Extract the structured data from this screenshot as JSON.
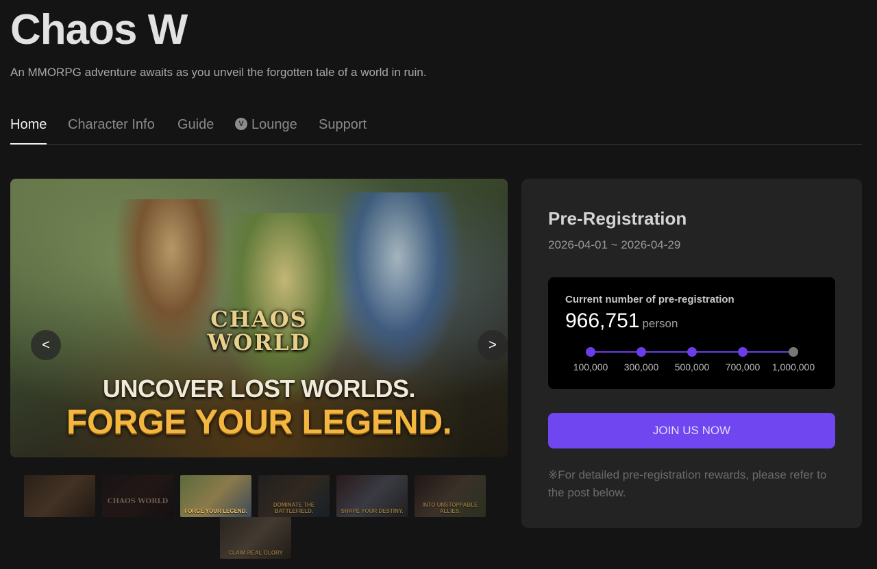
{
  "header": {
    "title": "Chaos W",
    "subtitle": "An MMORPG adventure awaits as you unveil the forgotten tale of a world in ruin."
  },
  "nav": {
    "tabs": [
      {
        "label": "Home",
        "active": true
      },
      {
        "label": "Character Info"
      },
      {
        "label": "Guide"
      },
      {
        "label": "Lounge",
        "icon": "lounge-icon"
      },
      {
        "label": "Support"
      }
    ]
  },
  "banner": {
    "logo_line1": "CHAOS",
    "logo_line2": "WORLD",
    "tagline1": "UNCOVER LOST WORLDS.",
    "tagline2": "FORGE YOUR LEGEND.",
    "prev_label": "<",
    "next_label": ">"
  },
  "thumbnails": [
    {
      "caption": ""
    },
    {
      "caption": "CHAOS WORLD"
    },
    {
      "caption": "FORGE YOUR LEGEND.",
      "active": true
    },
    {
      "caption": "DOMINATE THE BATTLEFIELD."
    },
    {
      "caption": "SHAPE YOUR DESTINY."
    },
    {
      "caption": "INTO UNSTOPPABLE ALLIES."
    },
    {
      "caption": "CLAIM REAL GLORY"
    }
  ],
  "preregistration": {
    "title": "Pre-Registration",
    "dates": "2026-04-01 ~ 2026-04-29",
    "counter_label": "Current number of pre-registration",
    "count": "966,751",
    "unit": "person",
    "milestones": [
      {
        "label": "100,000",
        "reached": true
      },
      {
        "label": "300,000",
        "reached": true
      },
      {
        "label": "500,000",
        "reached": true
      },
      {
        "label": "700,000",
        "reached": true
      },
      {
        "label": "1,000,000",
        "reached": false
      }
    ],
    "join_label": "JOIN US NOW",
    "note": "※For detailed pre-registration rewards, please refer to the post below."
  },
  "colors": {
    "accent": "#7046f0",
    "background": "#141414",
    "panel": "#232323"
  }
}
